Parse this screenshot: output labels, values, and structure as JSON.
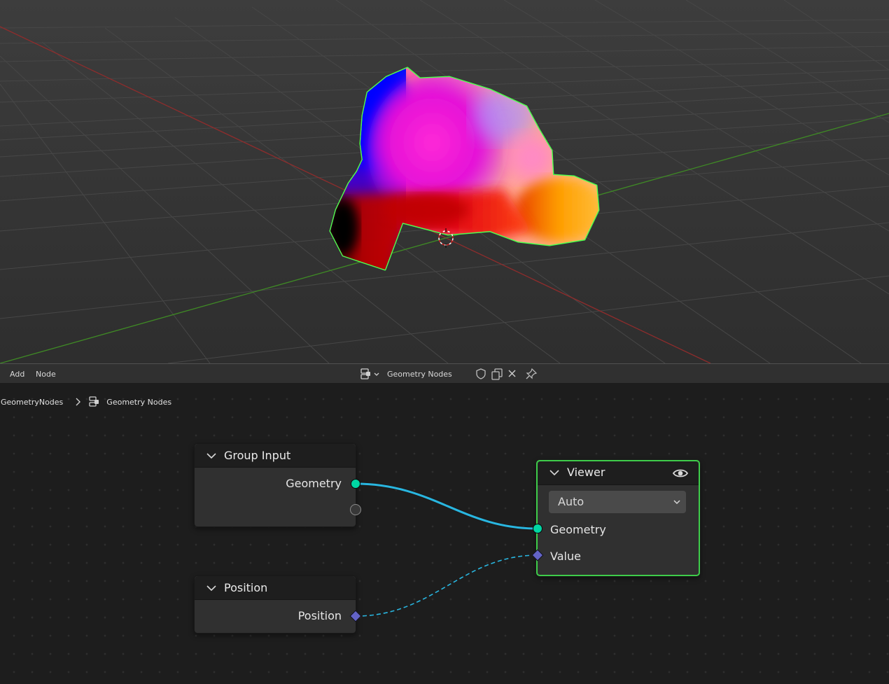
{
  "header": {
    "menu_add": "Add",
    "menu_node": "Node",
    "tree_name": "Geometry Nodes",
    "icons": [
      "node-tree-type-icon",
      "fake-user-shield-icon",
      "duplicate-icon",
      "unlink-icon",
      "pin-icon"
    ]
  },
  "breadcrumb": {
    "object": "GeometryNodes",
    "tree": "Geometry Nodes"
  },
  "nodes": {
    "group_input": {
      "title": "Group Input",
      "outputs": [
        "Geometry"
      ]
    },
    "position": {
      "title": "Position",
      "outputs": [
        "Position"
      ]
    },
    "viewer": {
      "title": "Viewer",
      "domain": "Auto",
      "inputs": [
        "Geometry",
        "Value"
      ]
    }
  },
  "colors": {
    "geometry_socket": "#00d6a3",
    "vector_socket": "#6363c7",
    "link": "#29b6e0",
    "selection_outline": "#3ecc4a",
    "x_axis": "#9a3030",
    "y_axis": "#4f8f2c"
  }
}
